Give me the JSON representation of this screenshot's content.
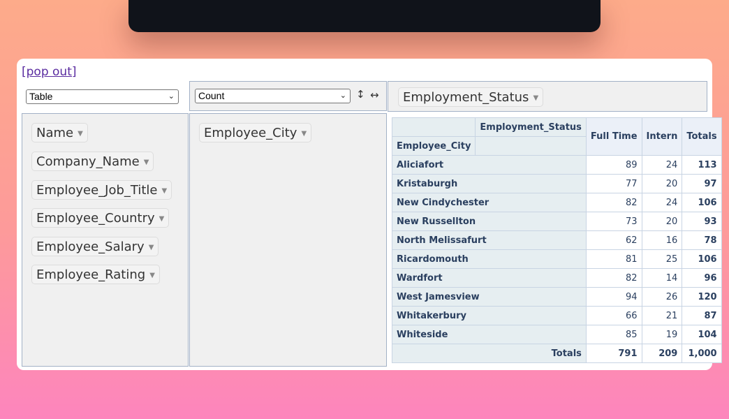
{
  "popout_link": "[pop out]",
  "renderer": {
    "selected": "Table"
  },
  "aggregator": {
    "selected": "Count"
  },
  "controls": {
    "row_order_icon": "↕",
    "col_order_icon": "↔"
  },
  "column_attribute": "Employment_Status",
  "unused_attributes": [
    "Name",
    "Company_Name",
    "Employee_Job_Title",
    "Employee_Country",
    "Employee_Salary",
    "Employee_Rating"
  ],
  "row_attribute": "Employee_City",
  "pivot": {
    "col_axis_label": "Employment_Status",
    "row_axis_label": "Employee_City",
    "col_headers": [
      "Full Time",
      "Intern",
      "Totals"
    ],
    "rows": [
      {
        "label": "Aliciafort",
        "values": [
          "89",
          "24",
          "113"
        ]
      },
      {
        "label": "Kristaburgh",
        "values": [
          "77",
          "20",
          "97"
        ]
      },
      {
        "label": "New Cindychester",
        "values": [
          "82",
          "24",
          "106"
        ]
      },
      {
        "label": "New Russellton",
        "values": [
          "73",
          "20",
          "93"
        ]
      },
      {
        "label": "North Melissafurt",
        "values": [
          "62",
          "16",
          "78"
        ]
      },
      {
        "label": "Ricardomouth",
        "values": [
          "81",
          "25",
          "106"
        ]
      },
      {
        "label": "Wardfort",
        "values": [
          "82",
          "14",
          "96"
        ]
      },
      {
        "label": "West Jamesview",
        "values": [
          "94",
          "26",
          "120"
        ]
      },
      {
        "label": "Whitakerbury",
        "values": [
          "66",
          "21",
          "87"
        ]
      },
      {
        "label": "Whiteside",
        "values": [
          "85",
          "19",
          "104"
        ]
      }
    ],
    "totals_label": "Totals",
    "totals": [
      "791",
      "209",
      "1,000"
    ]
  }
}
